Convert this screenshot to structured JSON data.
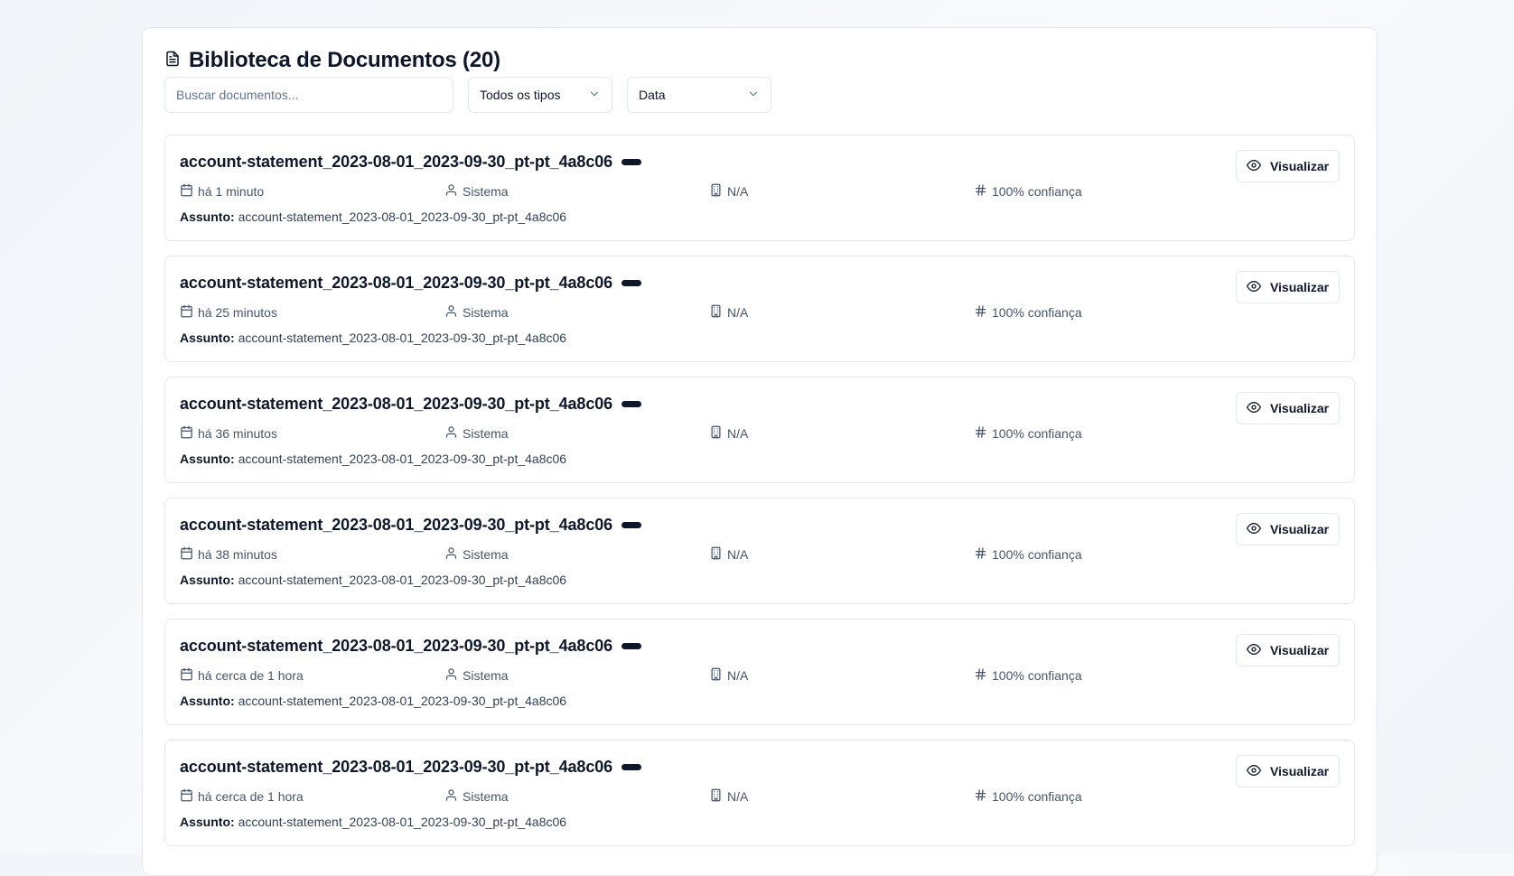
{
  "header": {
    "title": "Biblioteca de Documentos (20)",
    "icon": "file-text-icon"
  },
  "filters": {
    "search_placeholder": "Buscar documentos...",
    "type_select": "Todos os tipos",
    "sort_select": "Data"
  },
  "labels": {
    "subject_prefix": "Assunto:",
    "view_button": "Visualizar"
  },
  "documents": [
    {
      "title": "account-statement_2023-08-01_2023-09-30_pt-pt_4a8c06",
      "date": "há 1 minuto",
      "author": "Sistema",
      "company": "N/A",
      "confidence": "100% confiança",
      "subject": "account-statement_2023-08-01_2023-09-30_pt-pt_4a8c06"
    },
    {
      "title": "account-statement_2023-08-01_2023-09-30_pt-pt_4a8c06",
      "date": "há 25 minutos",
      "author": "Sistema",
      "company": "N/A",
      "confidence": "100% confiança",
      "subject": "account-statement_2023-08-01_2023-09-30_pt-pt_4a8c06"
    },
    {
      "title": "account-statement_2023-08-01_2023-09-30_pt-pt_4a8c06",
      "date": "há 36 minutos",
      "author": "Sistema",
      "company": "N/A",
      "confidence": "100% confiança",
      "subject": "account-statement_2023-08-01_2023-09-30_pt-pt_4a8c06"
    },
    {
      "title": "account-statement_2023-08-01_2023-09-30_pt-pt_4a8c06",
      "date": "há 38 minutos",
      "author": "Sistema",
      "company": "N/A",
      "confidence": "100% confiança",
      "subject": "account-statement_2023-08-01_2023-09-30_pt-pt_4a8c06"
    },
    {
      "title": "account-statement_2023-08-01_2023-09-30_pt-pt_4a8c06",
      "date": "há cerca de 1 hora",
      "author": "Sistema",
      "company": "N/A",
      "confidence": "100% confiança",
      "subject": "account-statement_2023-08-01_2023-09-30_pt-pt_4a8c06"
    },
    {
      "title": "account-statement_2023-08-01_2023-09-30_pt-pt_4a8c06",
      "date": "há cerca de 1 hora",
      "author": "Sistema",
      "company": "N/A",
      "confidence": "100% confiança",
      "subject": "account-statement_2023-08-01_2023-09-30_pt-pt_4a8c06"
    }
  ],
  "colors": {
    "text": "#0f172a",
    "muted": "#475569",
    "border": "#e5e7eb",
    "badge": "#0f172a"
  }
}
